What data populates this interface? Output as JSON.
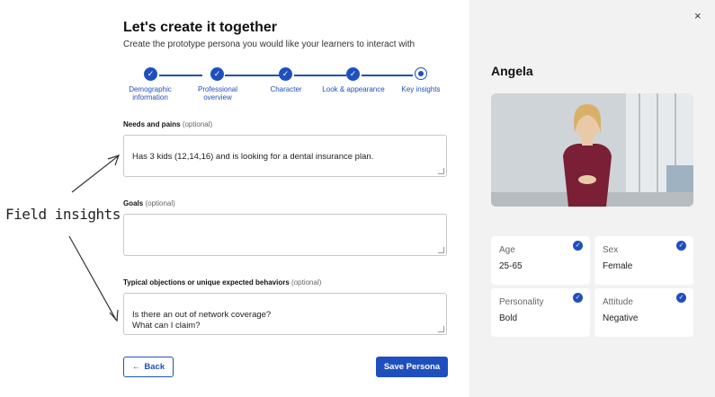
{
  "header": {
    "title": "Let's create it together",
    "subtitle": "Create the prototype persona you would like your learners to interact with"
  },
  "stepper": {
    "steps": [
      {
        "label": "Demographic information",
        "state": "complete"
      },
      {
        "label": "Professional overview",
        "state": "complete"
      },
      {
        "label": "Character",
        "state": "complete"
      },
      {
        "label": "Look & appearance",
        "state": "complete"
      },
      {
        "label": "Key insights",
        "state": "current"
      }
    ],
    "check_glyph": "✓"
  },
  "fields": {
    "needs": {
      "label": "Needs and pains",
      "optional": "(optional)",
      "value": "Has 3 kids (12,14,16) and is looking for a dental insurance plan."
    },
    "goals": {
      "label": "Goals",
      "optional": "(optional)",
      "value": ""
    },
    "objections": {
      "label": "Typical objections or unique expected behaviors",
      "optional": "(optional)",
      "value": "Is there an out of network coverage?\nWhat can I claim?"
    }
  },
  "buttons": {
    "back": "Back",
    "back_icon": "←",
    "save": "Save Persona"
  },
  "annotation": "Field insights",
  "persona": {
    "name": "Angela",
    "attributes": [
      {
        "key": "Age",
        "value": "25-65"
      },
      {
        "key": "Sex",
        "value": "Female"
      },
      {
        "key": "Personality",
        "value": "Bold"
      },
      {
        "key": "Attitude",
        "value": "Negative"
      }
    ],
    "close_glyph": "×"
  },
  "colors": {
    "accent": "#1f4fbf",
    "panel": "#f2f2f2"
  }
}
